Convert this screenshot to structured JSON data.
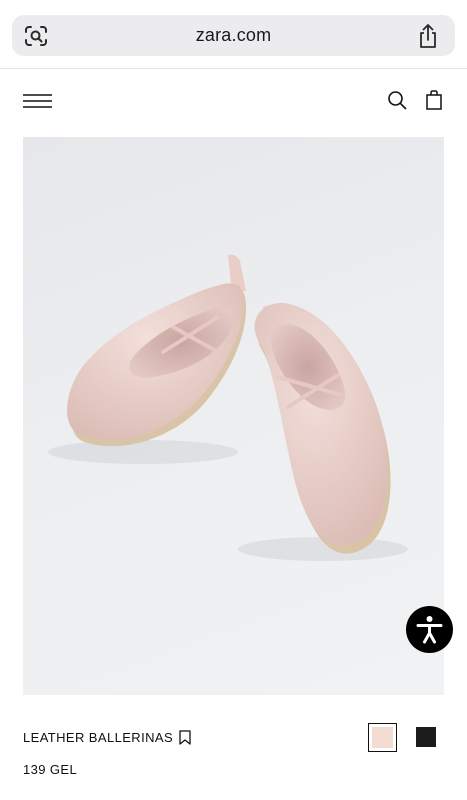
{
  "browser": {
    "url": "zara.com",
    "icons": {
      "left": "visual-search-icon",
      "right": "share-icon"
    }
  },
  "header": {
    "icons": [
      "menu-icon",
      "search-icon",
      "shopping-bag-icon"
    ]
  },
  "product": {
    "name": "LEATHER BALLERINAS",
    "price": "139 GEL",
    "colors": [
      {
        "hex": "#f3ddd2",
        "selected": true
      },
      {
        "hex": "#1c1c1c",
        "selected": false
      }
    ],
    "shoe_color": "#efd6d1"
  },
  "accessibility_button": {
    "icon": "accessibility-icon",
    "color": "#000000"
  }
}
